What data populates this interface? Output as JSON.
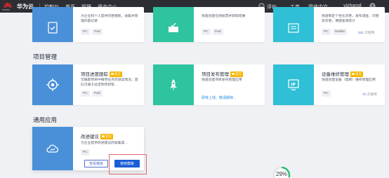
{
  "topbar": {
    "logo_text": "HUAWEI",
    "brand": "华为云",
    "nav": [
      "控制台",
      "首页",
      "管理",
      "资产中心"
    ],
    "rating": "评价",
    "ticket": "工单",
    "language": "简体中文",
    "username": "yizhangl",
    "icons": [
      "globe-icon",
      "smile-icon"
    ]
  },
  "top_row": {
    "card1": {
      "desc": "为企业和个人提供问卷模板，收集并管理问题记录",
      "tags": [
        "PC",
        "Pad"
      ]
    },
    "card2": {
      "desc": "快速创建在线投票并获取结果",
      "tags": [
        "PC",
        "Pad"
      ]
    },
    "card3": {
      "desc": "快速制定个性化问卷，发布调查、问卷及问卷，便捷查阅统计",
      "tags": [
        "PC",
        "Mobile"
      ],
      "count": "331",
      "count_suffix": "次使用"
    }
  },
  "project_section": {
    "title": "项目管理",
    "cards": [
      {
        "name": "项目进度跟踪",
        "badge": "官方",
        "desc": "可跟踪项目中每项任务的进度情况，团队可基于此定制项目管…",
        "tags": [
          "PC",
          "Pad"
        ]
      },
      {
        "name": "项目发布管理",
        "badge": "官方",
        "desc": "快速创建项目发布管理应用",
        "links": "即将上线、敬请期待…"
      },
      {
        "name": "设备维修管理",
        "badge": "官方",
        "desc": "快速创建设备（电梯）维修管理应用",
        "tags": [
          "PC"
        ],
        "count": "70",
        "count_suffix": "次使用"
      }
    ]
  },
  "general_section": {
    "title": "通用应用",
    "card": {
      "name": "改进建议",
      "badge": "官方",
      "desc": "为企业提供改进建议的收集渠…",
      "tags": [
        "PC"
      ],
      "view_label": "查看模板",
      "use_label": "使用模板"
    }
  },
  "progress": {
    "value": 29,
    "label": "29%"
  },
  "colors": {
    "blue_pane": "#4a90d9",
    "green_pane": "#2ec4a0",
    "teal_pane": "#2fbfd6",
    "accent": "#1a5cd6",
    "badge": "#f7b500"
  }
}
